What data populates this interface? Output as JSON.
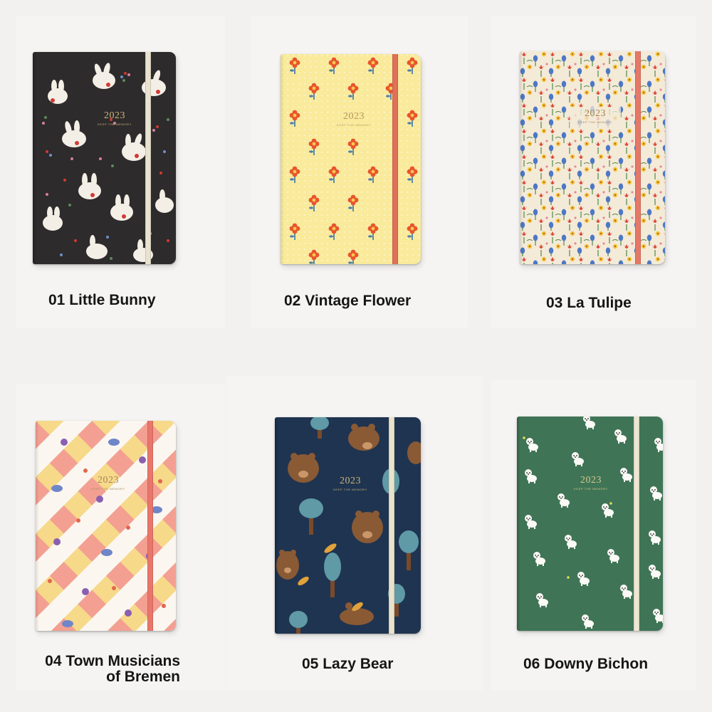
{
  "products": [
    {
      "label_lines": [
        "01 Little Bunny"
      ],
      "year": "2023",
      "tagline": "KEEP THE MEMORY",
      "cover_color": "#2d2b2c",
      "band_color": "#e8e2cf",
      "pattern": "bunny-icon"
    },
    {
      "label_lines": [
        "02 Vintage Flower"
      ],
      "year": "2023",
      "tagline": "KEEP THE MEMORY",
      "cover_color": "#f9ea9c",
      "band_color": "#e0705a",
      "pattern": "flower-icon"
    },
    {
      "label_lines": [
        "03 La Tulipe"
      ],
      "year": "2023",
      "tagline": "KEEP THE MEMORY",
      "cover_color": "#f4ead8",
      "band_color": "#e57867",
      "pattern": "tulip-icon"
    },
    {
      "label_lines": [
        "04 Town Musicians",
        "of Bremen"
      ],
      "year": "2023",
      "tagline": "KEEP THE MEMORY",
      "cover_color": "#f6f1ea",
      "band_color": "#e9766a",
      "pattern": "animals-icon"
    },
    {
      "label_lines": [
        "05 Lazy Bear"
      ],
      "year": "2023",
      "tagline": "KEEP THE MEMORY",
      "cover_color": "#1f3450",
      "band_color": "#eae3c9",
      "pattern": "bear-icon"
    },
    {
      "label_lines": [
        "06 Downy Bichon"
      ],
      "year": "2023",
      "tagline": "KEEP THE MEMORY",
      "cover_color": "#3f7556",
      "band_color": "#ece7d3",
      "pattern": "bichon-icon"
    }
  ]
}
